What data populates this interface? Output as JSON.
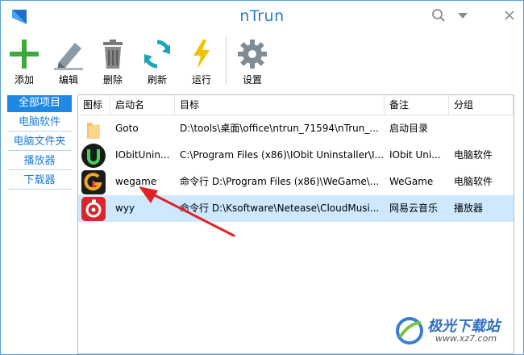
{
  "window": {
    "title": "nTrun"
  },
  "toolbar": {
    "add_label": "添加",
    "edit_label": "编辑",
    "delete_label": "删除",
    "refresh_label": "刷新",
    "run_label": "运行",
    "settings_label": "设置"
  },
  "sidebar": {
    "items": [
      {
        "label": "全部项目"
      },
      {
        "label": "电脑软件"
      },
      {
        "label": "电脑文件夹"
      },
      {
        "label": "播放器"
      },
      {
        "label": "下载器"
      }
    ]
  },
  "list": {
    "headers": {
      "icon": "图标",
      "name": "启动名",
      "target": "目标",
      "note": "备注",
      "group": "分组"
    },
    "rows": [
      {
        "name": "Goto",
        "target": "D:\\tools\\桌面\\office\\ntrun_71594\\nTrun_...",
        "note": "启动目录",
        "group": "",
        "icon": "folder-icon"
      },
      {
        "name": "IObitUnin...",
        "target": "C:\\Program Files (x86)\\IObit Uninstaller\\I...",
        "note": "IObit Uni...",
        "group": "电脑软件",
        "icon": "iobit-icon"
      },
      {
        "name": "wegame",
        "target": "命令行 D:\\Program Files (x86)\\WeGame\\...",
        "note": "WeGame",
        "group": "电脑软件",
        "icon": "wegame-icon"
      },
      {
        "name": "wyy",
        "target": "命令行 D:\\Ksoftware\\Netease\\CloudMusi...",
        "note": "网易云音乐",
        "group": "播放器",
        "icon": "netease-music-icon"
      }
    ]
  },
  "watermark": {
    "text": "极光下载站",
    "url": "www.xz7.com"
  },
  "colors": {
    "accent": "#1e88e5",
    "title": "#2a7ad0",
    "selected_row": "#cde8ff",
    "arrow": "#e02424"
  }
}
